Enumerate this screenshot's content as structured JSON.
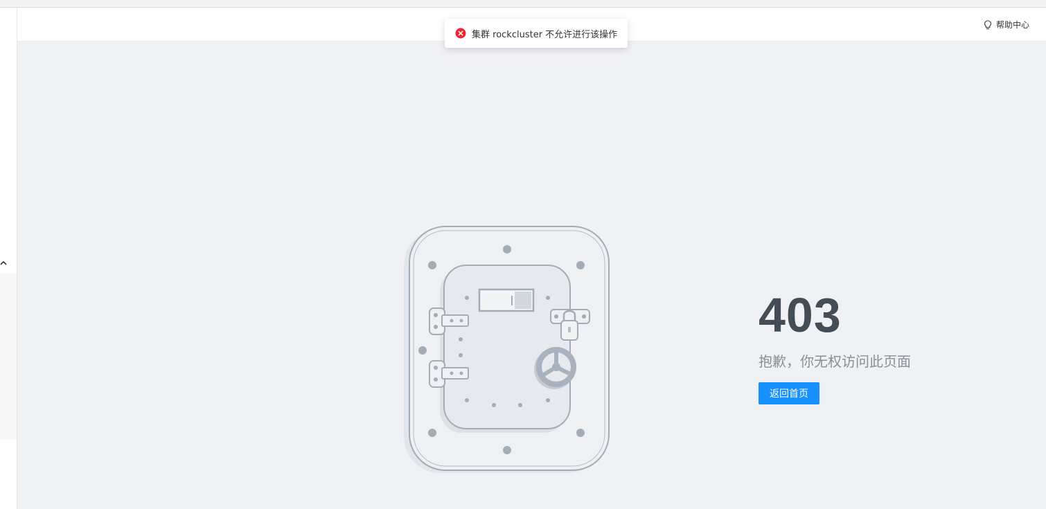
{
  "toast": {
    "message": "集群 rockcluster 不允许进行该操作",
    "icon": "error-circle-icon",
    "icon_color": "#f5222d"
  },
  "header": {
    "help_label": "帮助中心",
    "help_icon": "lightbulb-icon"
  },
  "sidebar": {
    "collapse_icon": "chevron-up-icon"
  },
  "error": {
    "code": "403",
    "description": "抱歉，你无权访问此页面",
    "back_button_label": "返回首页",
    "illustration": "locked-vault-door-icon"
  },
  "colors": {
    "accent": "#1890ff",
    "background": "#f0f1f5",
    "code_text": "#444c55"
  }
}
